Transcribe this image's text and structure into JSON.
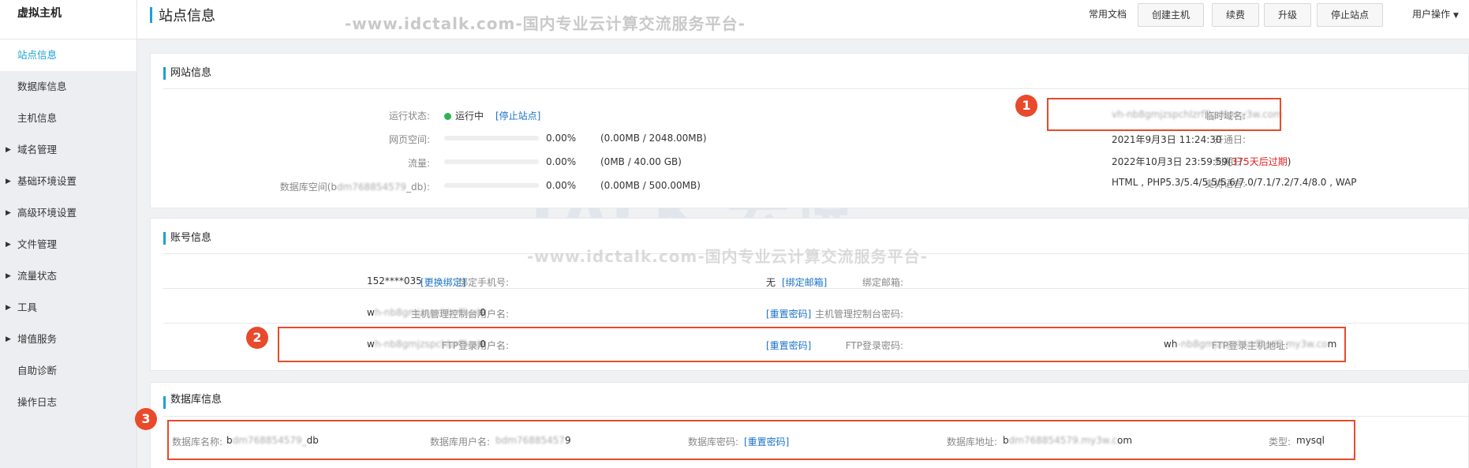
{
  "sidebar": {
    "title": "虚拟主机",
    "items": [
      {
        "label": "站点信息"
      },
      {
        "label": "数据库信息"
      },
      {
        "label": "主机信息"
      },
      {
        "label": "域名管理"
      },
      {
        "label": "基础环境设置"
      },
      {
        "label": "高级环境设置"
      },
      {
        "label": "文件管理"
      },
      {
        "label": "流量状态"
      },
      {
        "label": "工具"
      },
      {
        "label": "增值服务"
      },
      {
        "label": "自助诊断"
      },
      {
        "label": "操作日志"
      }
    ]
  },
  "header": {
    "title": "站点信息",
    "watermark": "-www.idctalk.com-国内专业云计算交流服务平台-",
    "docs": "常用文档",
    "buttons": {
      "create": "创建主机",
      "renew": "续费",
      "upgrade": "升级",
      "stop": "停止站点"
    },
    "user_menu": "用户操作"
  },
  "site_info": {
    "title": "网站信息",
    "status_label": "运行状态:",
    "status_value": "运行中",
    "stop_link": "[停止站点]",
    "space_label": "网页空间:",
    "space_pct": "0.00%",
    "space_detail": "(0.00MB / 2048.00MB)",
    "space_fill": 0,
    "traffic_label": "流量:",
    "traffic_pct": "0.00%",
    "traffic_detail": "(0MB / 40.00 GB)",
    "traffic_fill": 0,
    "db_space_label_prefix": "数据库空间(b",
    "db_space_label_blur": "dm768854579",
    "db_space_label_suffix": "_db):",
    "db_space_pct": "0.00%",
    "db_space_detail": "(0.00MB / 500.00MB)",
    "db_space_fill": 0,
    "temp_domain_label": "临时域名:",
    "temp_domain_value": "vh-nb8gmjzspchlzrf5gd0.my3w.com",
    "open_date_label": "开通日:",
    "open_date_value": "2021年9月3日 11:24:30",
    "expire_label": "到期日:",
    "expire_value": "2022年10月3日 23:59:59(",
    "expire_remaining": "375天后过期",
    "expire_close": ")",
    "lang_label": "支持语言:",
    "lang_value": "HTML , PHP5.3/5.4/5.5/5.6/7.0/7.1/7.2/7.4/8.0 , WAP"
  },
  "account_info": {
    "title": "账号信息",
    "phone_label": "绑定手机号:",
    "phone_value": "152****035",
    "phone_link": "[更换绑定]",
    "email_label": "绑定邮箱:",
    "email_value": "无",
    "email_link": "[绑定邮箱]",
    "console_user_label": "主机管理控制台用户名:",
    "console_user_first": "w",
    "console_user_blur": "h-nb8gmjzspchlzrf5gd",
    "console_user_last": "0",
    "console_pwd_label": "主机管理控制台密码:",
    "console_pwd_link": "[重置密码]",
    "ftp_user_label": "FTP登录用户名:",
    "ftp_user_first": "w",
    "ftp_user_blur": "h-nb8gmjzspchlzrf5gd",
    "ftp_user_last": "0",
    "ftp_pwd_label": "FTP登录密码:",
    "ftp_pwd_link": "[重置密码]",
    "ftp_host_label": "FTP登录主机地址:",
    "ftp_host_first": "wh",
    "ftp_host_blur": "-nb8gmjzspchlzrf5gd0.my3w.co",
    "ftp_host_last": "m"
  },
  "db_info": {
    "title": "数据库信息",
    "name_label": "数据库名称:",
    "name_first": "b",
    "name_blur": "dm768854579_",
    "name_last": "db",
    "user_label": "数据库用户名:",
    "user_blur": "bdm76885457",
    "user_last": "9",
    "pwd_label": "数据库密码:",
    "pwd_link": "[重置密码]",
    "addr_label": "数据库地址:",
    "addr_first": "b",
    "addr_blur": "dm768854579.my3w.c",
    "addr_last": "om",
    "type_label": "类型:",
    "type_value": "mysql"
  },
  "annotations": [
    "1",
    "2",
    "3"
  ],
  "watermarks": {
    "logo_text": "TALK 云说",
    "mid_text": "-www.idctalk.com-国内专业云计算交流服务平台-"
  },
  "colors": {
    "accent": "#1aa0d8",
    "link": "#1a73c8",
    "status_ok": "#2eb352",
    "annotation": "#e84a2b",
    "expire_warning": "#e02020"
  }
}
